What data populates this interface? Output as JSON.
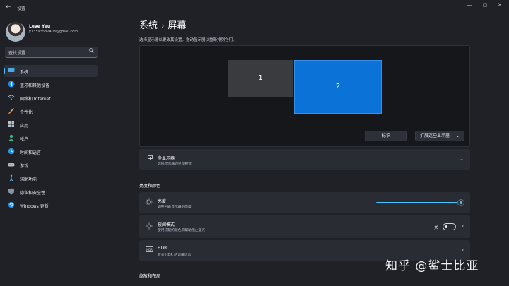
{
  "window": {
    "title": "设置",
    "back_icon": "back-arrow-icon",
    "minimize": "—",
    "maximize": "▢",
    "close": "✕"
  },
  "user": {
    "name": "Leve Yeu",
    "email": "y13593582403@gmail.com"
  },
  "search": {
    "placeholder": "查找设置"
  },
  "nav": {
    "items": [
      {
        "label": "系统",
        "icon": "monitor-icon",
        "active": true
      },
      {
        "label": "蓝牙和其他设备",
        "icon": "bluetooth-icon"
      },
      {
        "label": "网络和 Internet",
        "icon": "wifi-icon"
      },
      {
        "label": "个性化",
        "icon": "brush-icon"
      },
      {
        "label": "应用",
        "icon": "apps-icon"
      },
      {
        "label": "帐户",
        "icon": "person-icon"
      },
      {
        "label": "时间和语言",
        "icon": "globe-clock-icon"
      },
      {
        "label": "游戏",
        "icon": "gamepad-icon"
      },
      {
        "label": "辅助功能",
        "icon": "accessibility-icon"
      },
      {
        "label": "隐私和安全性",
        "icon": "shield-icon"
      },
      {
        "label": "Windows 更新",
        "icon": "update-icon"
      }
    ]
  },
  "main": {
    "breadcrumb_parent": "系统",
    "breadcrumb_sep": "›",
    "breadcrumb_current": "屏幕",
    "instruction": "选择显示器以更改其设置。拖动显示器以重新排列它们。",
    "monitor1_label": "1",
    "monitor2_label": "2",
    "identify_button": "标识",
    "extend_dropdown": "扩展这些显示器",
    "multi_display": {
      "title": "多显示器",
      "subtitle": "选择显示器的呈现模式"
    },
    "section_brightness": "亮度和颜色",
    "brightness": {
      "title": "亮度",
      "subtitle": "调整内置显示器的亮度",
      "value_fraction": 1.0
    },
    "night_light": {
      "title": "夜间模式",
      "subtitle": "使用较暖的颜色来帮助阻止蓝光",
      "toggle_state": "关"
    },
    "hdr": {
      "title": "HDR",
      "subtitle": "有关 HDR 的详细信息"
    },
    "section_scale": "缩放和布局"
  },
  "watermark": "知乎 @鲨士比亚",
  "colors": {
    "accent": "#4cc2ff",
    "selected_monitor": "#0b73d8",
    "background": "#1f2127",
    "card": "#2a2c33"
  }
}
